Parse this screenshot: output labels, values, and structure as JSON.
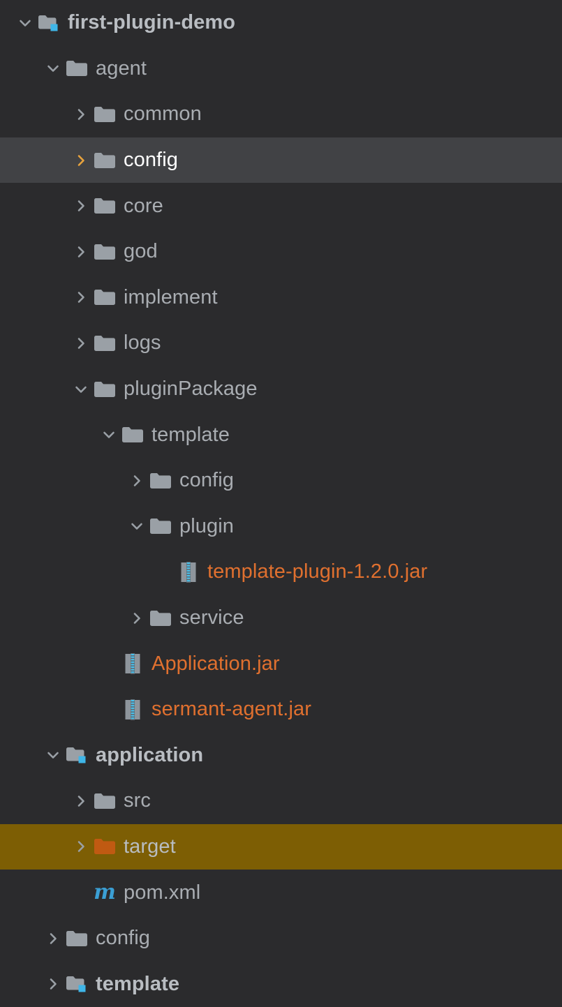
{
  "panel": {
    "name": "project-tree",
    "background": "#2b2b2d",
    "selected_row_background": "#414245",
    "highlight_row_background": "#7d5e04"
  },
  "colors": {
    "folder": "#9aa0a6",
    "folder_orange": "#c05a12",
    "module_marker": "#3fb6e8",
    "jar_text": "#e0702f",
    "dir_text": "#a9adb2",
    "module_text": "#b9bdc2",
    "selected_text": "#ffffff",
    "chevron": "#9aa0a6",
    "chevron_selected": "#e8a33d",
    "maven_icon": "#3b9fd4"
  },
  "rows": [
    {
      "label": "first-plugin-demo",
      "depth": 0,
      "twisty": "chevron-down",
      "icon": "module-folder-icon",
      "kind": "module",
      "state": "normal"
    },
    {
      "label": "agent",
      "depth": 1,
      "twisty": "chevron-down",
      "icon": "folder-icon",
      "kind": "dir",
      "state": "normal"
    },
    {
      "label": "common",
      "depth": 2,
      "twisty": "chevron-right",
      "icon": "folder-icon",
      "kind": "dir",
      "state": "normal"
    },
    {
      "label": "config",
      "depth": 2,
      "twisty": "chevron-right",
      "icon": "folder-icon",
      "kind": "dir",
      "state": "selected"
    },
    {
      "label": "core",
      "depth": 2,
      "twisty": "chevron-right",
      "icon": "folder-icon",
      "kind": "dir",
      "state": "normal"
    },
    {
      "label": "god",
      "depth": 2,
      "twisty": "chevron-right",
      "icon": "folder-icon",
      "kind": "dir",
      "state": "normal"
    },
    {
      "label": "implement",
      "depth": 2,
      "twisty": "chevron-right",
      "icon": "folder-icon",
      "kind": "dir",
      "state": "normal"
    },
    {
      "label": "logs",
      "depth": 2,
      "twisty": "chevron-right",
      "icon": "folder-icon",
      "kind": "dir",
      "state": "normal"
    },
    {
      "label": "pluginPackage",
      "depth": 2,
      "twisty": "chevron-down",
      "icon": "folder-icon",
      "kind": "dir",
      "state": "normal"
    },
    {
      "label": "template",
      "depth": 3,
      "twisty": "chevron-down",
      "icon": "folder-icon",
      "kind": "dir",
      "state": "normal"
    },
    {
      "label": "config",
      "depth": 4,
      "twisty": "chevron-right",
      "icon": "folder-icon",
      "kind": "dir",
      "state": "normal"
    },
    {
      "label": "plugin",
      "depth": 4,
      "twisty": "chevron-down",
      "icon": "folder-icon",
      "kind": "dir",
      "state": "normal"
    },
    {
      "label": "template-plugin-1.2.0.jar",
      "depth": 5,
      "twisty": "none",
      "icon": "jar-archive-icon",
      "kind": "jar",
      "state": "normal"
    },
    {
      "label": "service",
      "depth": 4,
      "twisty": "chevron-right",
      "icon": "folder-icon",
      "kind": "dir",
      "state": "normal"
    },
    {
      "label": "Application.jar",
      "depth": 3,
      "twisty": "none",
      "icon": "jar-archive-icon",
      "kind": "jar",
      "state": "normal"
    },
    {
      "label": "sermant-agent.jar",
      "depth": 3,
      "twisty": "none",
      "icon": "jar-archive-icon",
      "kind": "jar",
      "state": "normal"
    },
    {
      "label": "application",
      "depth": 1,
      "twisty": "chevron-down",
      "icon": "module-folder-icon",
      "kind": "module",
      "state": "normal"
    },
    {
      "label": "src",
      "depth": 2,
      "twisty": "chevron-right",
      "icon": "folder-icon",
      "kind": "dir",
      "state": "normal"
    },
    {
      "label": "target",
      "depth": 2,
      "twisty": "chevron-right",
      "icon": "folder-orange-icon",
      "kind": "dir",
      "state": "highlighted"
    },
    {
      "label": "pom.xml",
      "depth": 2,
      "twisty": "none",
      "icon": "maven-pom-icon",
      "kind": "file",
      "state": "normal"
    },
    {
      "label": "config",
      "depth": 1,
      "twisty": "chevron-right",
      "icon": "folder-icon",
      "kind": "dir",
      "state": "normal"
    },
    {
      "label": "template",
      "depth": 1,
      "twisty": "chevron-right",
      "icon": "module-folder-icon",
      "kind": "module",
      "state": "normal"
    }
  ]
}
